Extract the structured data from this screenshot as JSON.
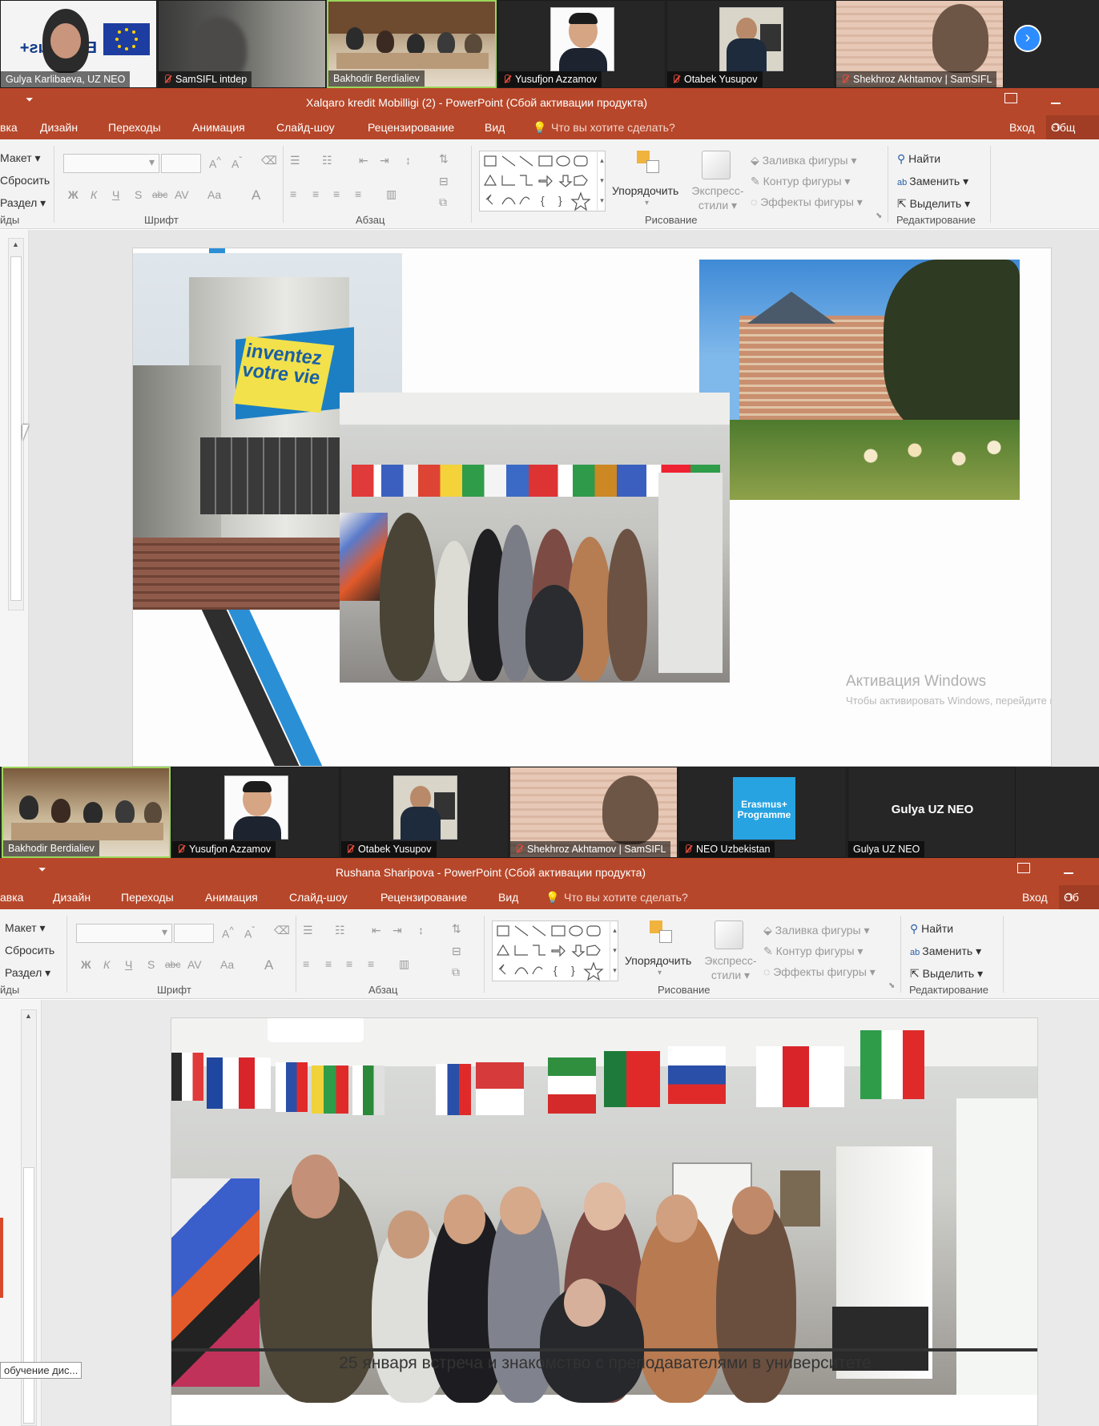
{
  "top_strip": {
    "participants": [
      {
        "name": "Gulya Karlibaeva, UZ NEO",
        "muted": false,
        "logo_text": "Erasmus+"
      },
      {
        "name": "SamSIFL intdep",
        "muted": true
      },
      {
        "name": "Bakhodir Berdialiev",
        "muted": false,
        "active": true
      },
      {
        "name": "Yusufjon Azzamov",
        "muted": true
      },
      {
        "name": "Otabek Yusupov",
        "muted": true
      },
      {
        "name": "Shekhroz Akhtamov | SamSIFL",
        "muted": true
      }
    ],
    "next_icon": "chevron-right-icon"
  },
  "ppt1": {
    "window_title": "Xalqaro kredit Mobilligi (2) - PowerPoint (Сбой активации продукта)",
    "tabs": [
      "вка",
      "Дизайн",
      "Переходы",
      "Анимация",
      "Слайд-шоу",
      "Рецензирование",
      "Вид"
    ],
    "tell_me": "Что вы хотите сделать?",
    "signin": "Вход",
    "share": "Общ",
    "slides_group": {
      "layout": "Макет",
      "reset": "Сбросить",
      "section": "Раздел",
      "label": "йды"
    },
    "font_group_label": "Шрифт",
    "paragraph_group_label": "Абзац",
    "drawing": {
      "arrange": "Упорядочить",
      "quick_styles_1": "Экспресс-",
      "quick_styles_2": "стили",
      "fill": "Заливка фигуры",
      "outline": "Контур фигуры",
      "effects": "Эффекты фигуры",
      "label": "Рисование"
    },
    "editing": {
      "find": "Найти",
      "replace": "Заменить",
      "select": "Выделить",
      "label": "Редактирование"
    },
    "font_buttons": {
      "bold": "Ж",
      "italic": "К",
      "underline": "Ч",
      "shadow": "S",
      "strike": "abc",
      "spacing": "AV",
      "case": "Aa",
      "color": "A"
    },
    "slide": {
      "banner_text": "inventez votre vie"
    },
    "activation_title": "Активация Windows",
    "activation_sub": "Чтобы активировать Windows, перейдите в ра"
  },
  "mid_strip": {
    "participants": [
      {
        "name": "Bakhodir Berdialiev",
        "muted": false,
        "active": true
      },
      {
        "name": "Yusufjon Azzamov",
        "muted": true
      },
      {
        "name": "Otabek Yusupov",
        "muted": true
      },
      {
        "name": "Shekhroz Akhtamov | SamSIFL",
        "muted": true
      },
      {
        "name": "NEO Uzbekistan",
        "muted": true,
        "logo_line1": "Erasmus+",
        "logo_line2": "Programme"
      },
      {
        "name": "Gulya UZ NEO",
        "muted": false,
        "center_text": "Gulya UZ NEO"
      }
    ]
  },
  "ppt2": {
    "window_title": "Rushana Sharipova - PowerPoint (Сбой активации продукта)",
    "tabs": [
      "авка",
      "Дизайн",
      "Переходы",
      "Анимация",
      "Слайд-шоу",
      "Рецензирование",
      "Вид"
    ],
    "tell_me": "Что вы хотите сделать?",
    "signin": "Вход",
    "share": "Об",
    "slides_group": {
      "layout": "Макет",
      "reset": "Сбросить",
      "section": "Раздел",
      "label": "йды"
    },
    "font_group_label": "Шрифт",
    "paragraph_group_label": "Абзац",
    "drawing": {
      "arrange": "Упорядочить",
      "quick_styles_1": "Экспресс-",
      "quick_styles_2": "стили",
      "fill": "Заливка фигуры",
      "outline": "Контур фигуры",
      "effects": "Эффекты фигуры",
      "label": "Рисование"
    },
    "editing": {
      "find": "Найти",
      "replace": "Заменить",
      "select": "Выделить",
      "label": "Редактирование"
    },
    "font_buttons": {
      "bold": "Ж",
      "italic": "К",
      "underline": "Ч",
      "shadow": "S",
      "strike": "abc",
      "spacing": "AV",
      "case": "Aa",
      "color": "A"
    },
    "caption": "25 января встреча и знакомство с преподавателями в университете",
    "tooltip": "обучение дис..."
  },
  "colors": {
    "ppt_accent": "#b7472a",
    "zoom_blue": "#2d8cff",
    "active_green": "#9bd65a"
  }
}
